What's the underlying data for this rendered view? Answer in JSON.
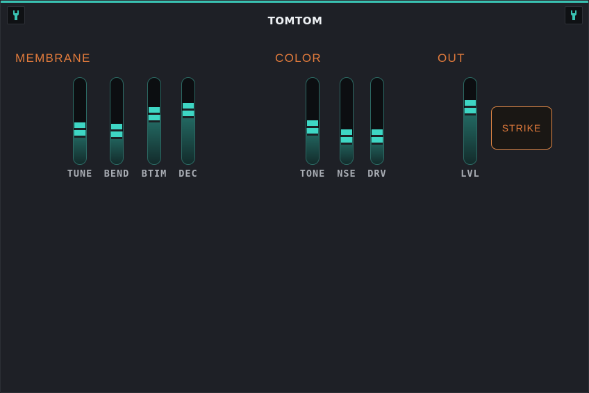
{
  "header": {
    "title": "TOMTOM"
  },
  "icons": {
    "left": "wrench-icon",
    "right": "wrench-icon"
  },
  "colors": {
    "accent": "#39c2b2",
    "label": "#e27b3c",
    "background": "#1e2026"
  },
  "sections": {
    "membrane": {
      "label": "MEMBRANE",
      "sliders": [
        {
          "label": "TUNE",
          "value": 0.32
        },
        {
          "label": "BEND",
          "value": 0.3
        },
        {
          "label": "BTIM",
          "value": 0.55
        },
        {
          "label": "DEC",
          "value": 0.62
        }
      ]
    },
    "color": {
      "label": "COLOR",
      "sliders": [
        {
          "label": "TONE",
          "value": 0.35
        },
        {
          "label": "NSE",
          "value": 0.21
        },
        {
          "label": "DRV",
          "value": 0.21
        }
      ]
    },
    "out": {
      "label": "OUT",
      "sliders": [
        {
          "label": "LVL",
          "value": 0.66
        }
      ],
      "strike_label": "STRIKE"
    }
  }
}
